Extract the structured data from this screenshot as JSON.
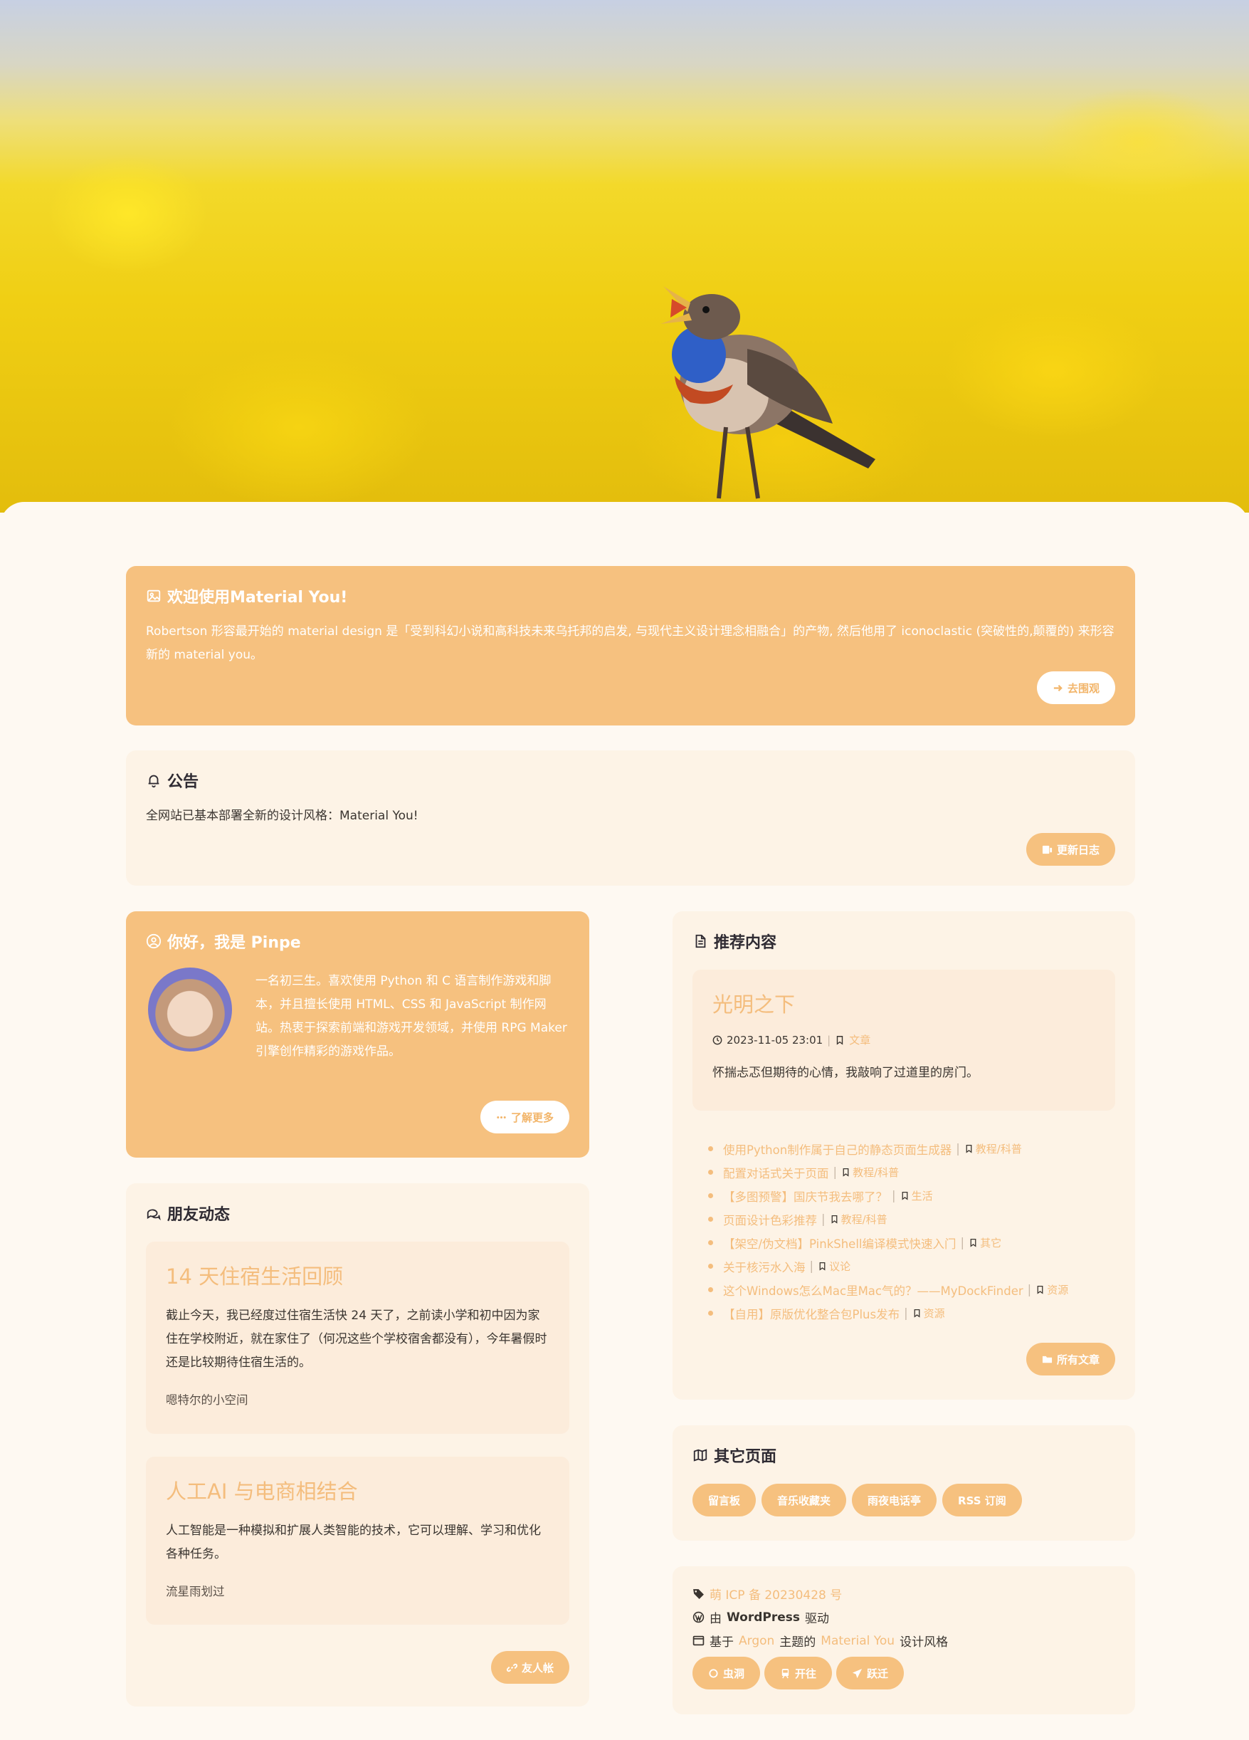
{
  "welcome": {
    "title": "欢迎使用Material You!",
    "text": "Robertson 形容最开始的 material design 是「受到科幻小说和高科技未来乌托邦的启发, 与现代主义设计理念相融合」的产物, 然后他用了 iconoclastic (突破性的,颠覆的) 来形容新的 material you。",
    "button": "去围观"
  },
  "notice": {
    "title": "公告",
    "text": "全网站已基本部署全新的设计风格：Material You!",
    "button": "更新日志"
  },
  "profile": {
    "title": "你好，我是 Pinpe",
    "text": "一名初三生。喜欢使用 Python 和 C 语言制作游戏和脚本，并且擅长使用 HTML、CSS 和 JavaScript 制作网站。热衷于探索前端和游戏开发领域，并使用 RPG Maker 引擎创作精彩的游戏作品。",
    "button": "了解更多"
  },
  "friends": {
    "title": "朋友动态",
    "posts": [
      {
        "title": "14 天住宿生活回顾",
        "excerpt": "截止今天，我已经度过住宿生活快 24 天了，之前读小学和初中因为家住在学校附近，就在家住了（何况这些个学校宿舍都没有），今年暑假时还是比较期待住宿生活的。",
        "author": "嗯特尔的小空间"
      },
      {
        "title": "人工AI 与电商相结合",
        "excerpt": "人工智能是一种模拟和扩展人类智能的技术，它可以理解、学习和优化各种任务。",
        "author": "流星雨划过"
      }
    ],
    "button": "友人帐"
  },
  "recommend": {
    "title": "推荐内容",
    "featured": {
      "title": "光明之下",
      "date": "2023-11-05 23:01",
      "category": "文章",
      "excerpt": "怀揣忐忑但期待的心情，我敲响了过道里的房门。"
    },
    "list": [
      {
        "title": "使用Python制作属于自己的静态页面生成器",
        "category": "教程/科普"
      },
      {
        "title": "配置对话式关于页面",
        "category": "教程/科普"
      },
      {
        "title": "【多图预警】国庆节我去哪了？",
        "category": "生活"
      },
      {
        "title": "页面设计色彩推荐",
        "category": "教程/科普"
      },
      {
        "title": "【架空/伪文档】PinkShell编译模式快速入门",
        "category": "其它"
      },
      {
        "title": "关于核污水入海",
        "category": "议论"
      },
      {
        "title": "这个Windows怎么Mac里Mac气的？——MyDockFinder",
        "category": "资源"
      },
      {
        "title": "【自用】原版优化整合包Plus发布",
        "category": "资源"
      }
    ],
    "button": "所有文章"
  },
  "other": {
    "title": "其它页面",
    "buttons": [
      "留言板",
      "音乐收藏夹",
      "雨夜电话亭",
      "RSS 订阅"
    ]
  },
  "footer": {
    "icp": "萌 ICP 备 20230428 号",
    "powered_prefix": "由",
    "powered_name": "WordPress",
    "powered_suffix": "驱动",
    "theme_prefix": "基于",
    "theme_name": "Argon",
    "theme_mid": "主题的",
    "style_name": "Material You",
    "style_suffix": "设计风格",
    "buttons": [
      "虫洞",
      "开往",
      "跃迁"
    ]
  },
  "colors": {
    "accent": "#f6c17f",
    "accent_text": "#f4bd7d",
    "card": "#fdf3e6",
    "page": "#fef9f2"
  }
}
